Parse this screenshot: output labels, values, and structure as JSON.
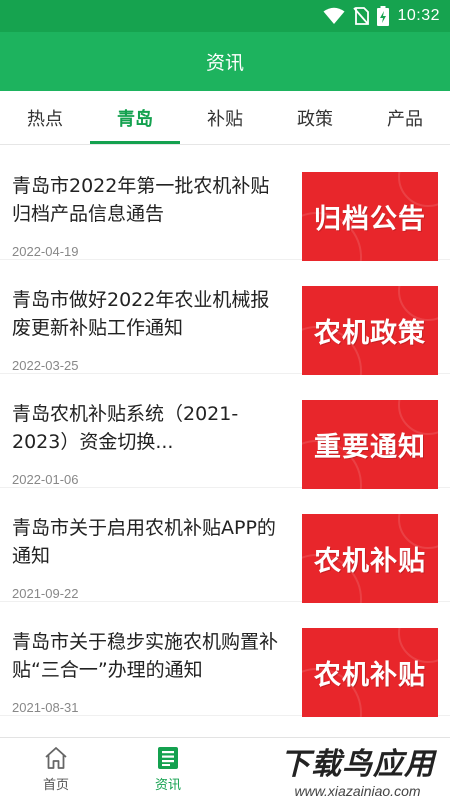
{
  "status_bar": {
    "time": "10:32"
  },
  "app_bar": {
    "title": "资讯"
  },
  "tabs": [
    {
      "label": "热点",
      "active": false
    },
    {
      "label": "青岛",
      "active": true
    },
    {
      "label": "补贴",
      "active": false
    },
    {
      "label": "政策",
      "active": false
    },
    {
      "label": "产品",
      "active": false
    }
  ],
  "articles": [
    {
      "title": "青岛市2022年第一批农机补贴归档产品信息通告",
      "date": "2022-04-19",
      "thumb_text": "归档公告"
    },
    {
      "title": "青岛市做好2022年农业机械报废更新补贴工作通知",
      "date": "2022-03-25",
      "thumb_text": "农机政策"
    },
    {
      "title": "青岛农机补贴系统（2021-2023）资金切换...",
      "date": "2022-01-06",
      "thumb_text": "重要通知"
    },
    {
      "title": "青岛市关于启用农机补贴APP的通知",
      "date": "2021-09-22",
      "thumb_text": "农机补贴"
    },
    {
      "title": "青岛市关于稳步实施农机购置补贴“三合一”办理的通知",
      "date": "2021-08-31",
      "thumb_text": "农机补贴"
    }
  ],
  "bottom_nav": [
    {
      "label": "首页",
      "icon": "home-icon",
      "active": false
    },
    {
      "label": "资讯",
      "icon": "news-icon",
      "active": true
    }
  ],
  "watermark": {
    "text": "下载鸟应用",
    "url": "www.xiazainiao.com"
  },
  "colors": {
    "brand_green": "#1db35e",
    "accent_green": "#14a14f",
    "thumb_red": "#e8262b"
  }
}
